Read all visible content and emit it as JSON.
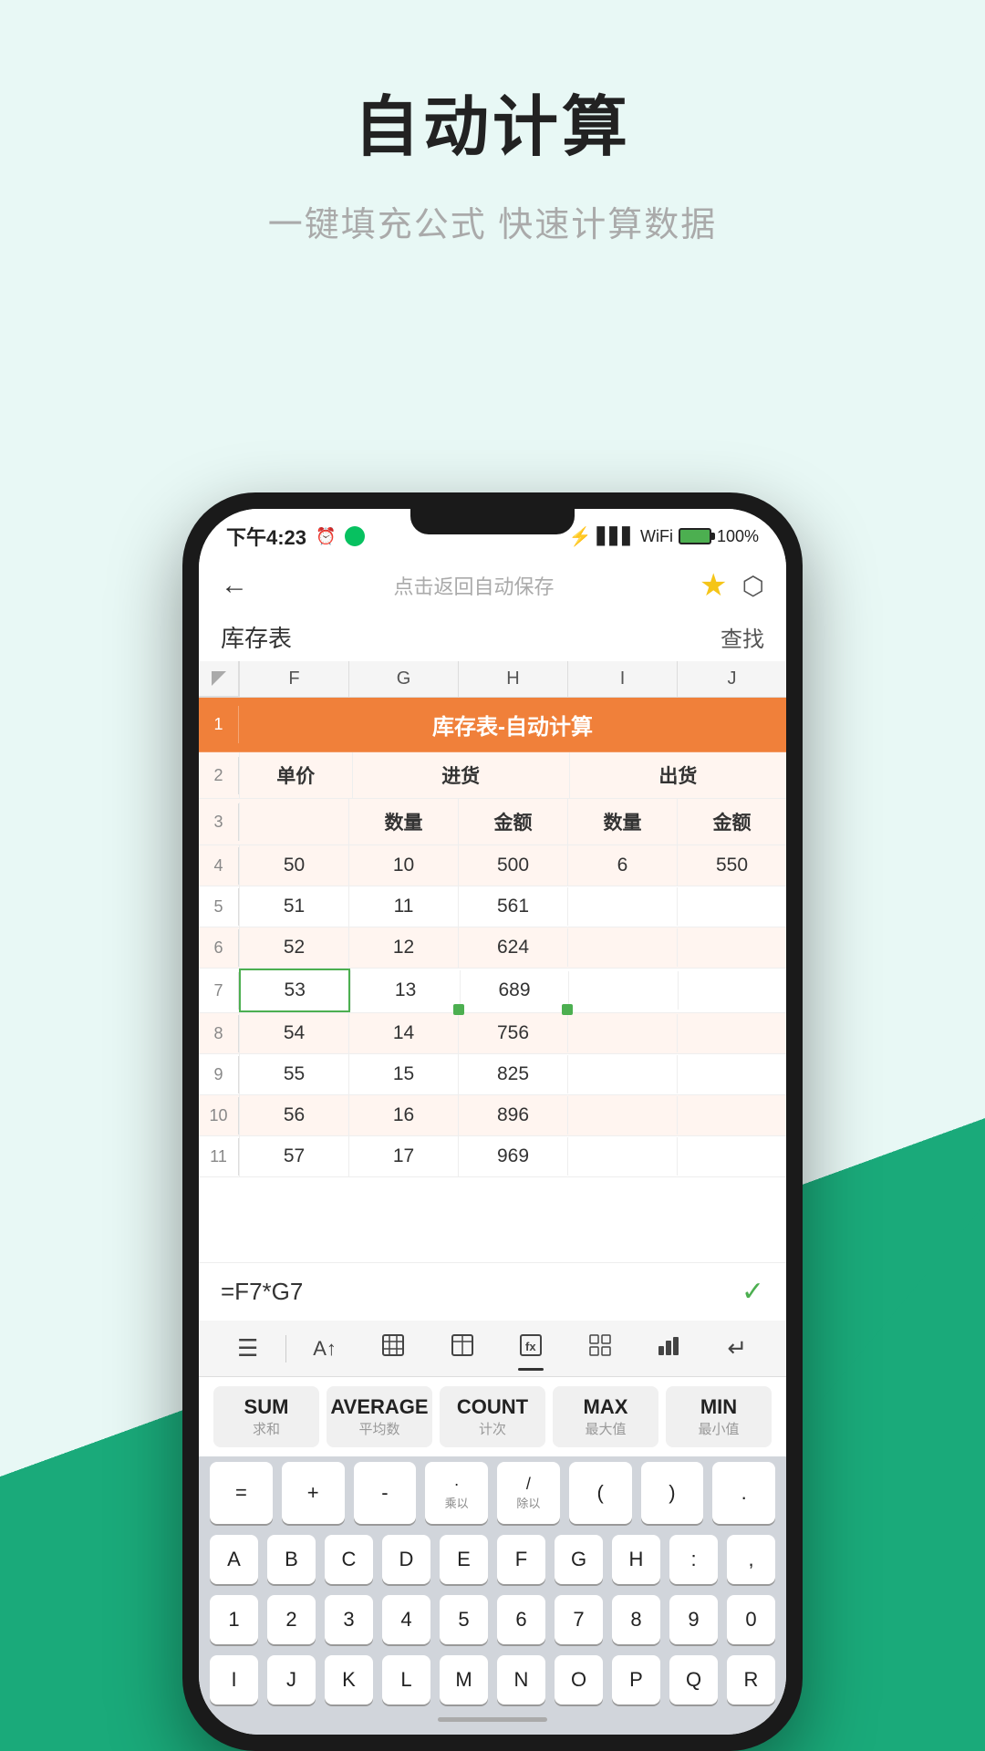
{
  "page": {
    "title": "自动计算",
    "subtitle": "一键填充公式 快速计算数据"
  },
  "status_bar": {
    "time": "下午4:23",
    "icons_left": [
      "alarm",
      "wechat"
    ],
    "battery": "100%"
  },
  "nav": {
    "back": "←",
    "center": "点击返回自动保存",
    "search": "查找"
  },
  "sheet": {
    "name": "库存表",
    "find": "查找",
    "col_headers": [
      "F",
      "G",
      "H",
      "I",
      "J"
    ],
    "title_row": {
      "row": 1,
      "text": "库存表-自动计算"
    },
    "header_row": {
      "row": 2,
      "cells": [
        "单价",
        "进货",
        "",
        "出货",
        ""
      ]
    },
    "sub_header": {
      "row": 3,
      "cells": [
        "",
        "数量",
        "金额",
        "数量",
        "金额"
      ]
    },
    "data_rows": [
      {
        "row": 4,
        "cells": [
          "50",
          "10",
          "500",
          "6",
          "550"
        ],
        "bg": "light"
      },
      {
        "row": 5,
        "cells": [
          "51",
          "11",
          "561",
          "",
          ""
        ],
        "bg": "white"
      },
      {
        "row": 6,
        "cells": [
          "52",
          "12",
          "624",
          "",
          ""
        ],
        "bg": "light"
      },
      {
        "row": 7,
        "cells": [
          "53",
          "13",
          "689",
          "",
          ""
        ],
        "bg": "white",
        "selected_col": 0
      },
      {
        "row": 8,
        "cells": [
          "54",
          "14",
          "756",
          "",
          ""
        ],
        "bg": "light"
      },
      {
        "row": 9,
        "cells": [
          "55",
          "15",
          "825",
          "",
          ""
        ],
        "bg": "white"
      },
      {
        "row": 10,
        "cells": [
          "56",
          "16",
          "896",
          "",
          ""
        ],
        "bg": "light"
      },
      {
        "row": 11,
        "cells": [
          "57",
          "17",
          "969",
          "",
          ""
        ],
        "bg": "white"
      }
    ]
  },
  "formula_bar": {
    "formula": "=F7*G7",
    "confirm": "✓"
  },
  "toolbar": {
    "icons": [
      "☰",
      "A↑",
      "⊞",
      "⊟",
      "⊠",
      "⊡",
      "⌦",
      "↵"
    ]
  },
  "functions": [
    {
      "name": "SUM",
      "desc": "求和"
    },
    {
      "name": "AVERAGE",
      "desc": "平均数"
    },
    {
      "name": "COUNT",
      "desc": "计次"
    },
    {
      "name": "MAX",
      "desc": "最大值"
    },
    {
      "name": "MIN",
      "desc": "最小值"
    }
  ],
  "keyboard": {
    "row1": [
      "=",
      "+",
      "-",
      "·乘以",
      "/除以",
      "(",
      ")",
      "."
    ],
    "row2": [
      "A",
      "B",
      "C",
      "D",
      "E",
      "F",
      "G",
      "H",
      ":",
      ","
    ],
    "row3": [
      "1",
      "2",
      "3",
      "4",
      "5",
      "6",
      "7",
      "8",
      "9",
      "0"
    ],
    "row4": [
      "I",
      "J",
      "K",
      "L",
      "M",
      "N",
      "O",
      "P",
      "Q",
      "R"
    ]
  }
}
